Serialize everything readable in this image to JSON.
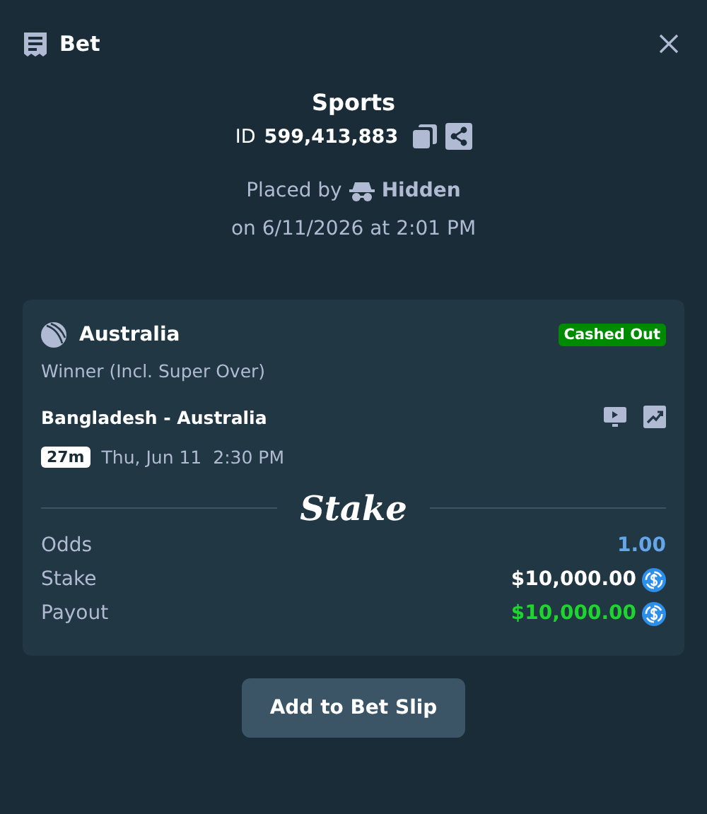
{
  "header": {
    "title": "Bet"
  },
  "summary": {
    "category": "Sports",
    "id_label": "ID",
    "id_value": "599,413,883",
    "placed_by_label": "Placed by",
    "placed_by_user": "Hidden",
    "placed_on": "on 6/11/2026 at 2:01 PM"
  },
  "selection": {
    "team": "Australia",
    "status": "Cashed Out",
    "market": "Winner (Incl. Super Over)",
    "event": "Bangladesh - Australia",
    "countdown": "27m",
    "date": "Thu, Jun 11",
    "time": "2:30 PM"
  },
  "brand": "Stake",
  "rows": [
    {
      "label": "Odds",
      "value": "1.00",
      "kind": "odds",
      "color": "#64a6e8"
    },
    {
      "label": "Stake",
      "value": "$10,000.00",
      "kind": "amount",
      "color": "#ffffff"
    },
    {
      "label": "Payout",
      "value": "$10,000.00",
      "kind": "amount",
      "color": "#1fd42f"
    }
  ],
  "buttons": [
    "Add to Bet Slip"
  ]
}
